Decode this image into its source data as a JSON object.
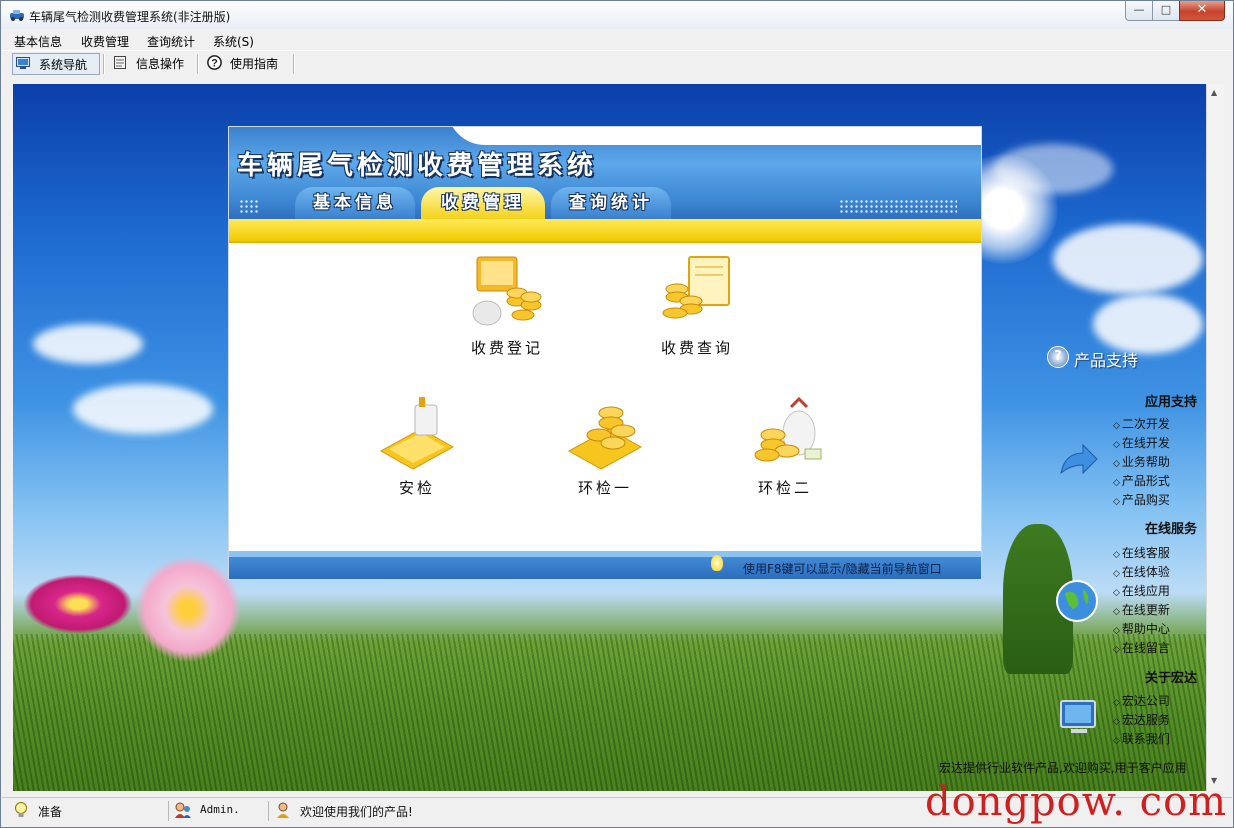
{
  "window": {
    "title": "车辆尾气检测收费管理系统(非注册版)",
    "controls": {
      "minimize": "—",
      "maximize": "□",
      "close": "✕"
    }
  },
  "menubar": {
    "items": [
      {
        "label": "基本信息"
      },
      {
        "label": "收费管理"
      },
      {
        "label": "查询统计"
      },
      {
        "label": "系统(S)"
      }
    ]
  },
  "toolbar": {
    "items": [
      {
        "label": "系统导航",
        "icon": "monitor-icon",
        "active": true
      },
      {
        "label": "信息操作",
        "icon": "document-icon",
        "active": false
      },
      {
        "label": "使用指南",
        "icon": "help-icon",
        "active": false
      }
    ]
  },
  "panel": {
    "title": "车辆尾气检测收费管理系统",
    "tabs": [
      {
        "label": "基本信息",
        "active": false
      },
      {
        "label": "收费管理",
        "active": true
      },
      {
        "label": "查询统计",
        "active": false
      }
    ],
    "functions": [
      {
        "label": "收费登记",
        "icon": "coins-register-icon"
      },
      {
        "label": "收费查询",
        "icon": "coins-query-icon"
      },
      {
        "label": "安检",
        "icon": "safety-check-icon"
      },
      {
        "label": "环检一",
        "icon": "env-check-one-icon"
      },
      {
        "label": "环检二",
        "icon": "env-check-two-icon"
      }
    ],
    "footer_tip": "使用F8键可以显示/隐藏当前导航窗口"
  },
  "sidebar": {
    "support_label": "产品支持",
    "sections": [
      {
        "title": "应用支持",
        "links": [
          "二次开发",
          "在线开发",
          "业务帮助",
          "产品形式",
          "产品购买"
        ]
      },
      {
        "title": "在线服务",
        "links": [
          "在线客服",
          "在线体验",
          "在线应用",
          "在线更新",
          "帮助中心",
          "在线留言"
        ]
      },
      {
        "title": "关于宏达",
        "links": [
          "宏达公司",
          "宏达服务",
          "联系我们"
        ]
      }
    ],
    "marquee": "宏达提供行业软件产品,欢迎购买,用于客户应用"
  },
  "statusbar": {
    "status": "准备",
    "user": "Admin.",
    "message": "欢迎使用我们的产品!"
  },
  "watermark": "dongpow. com",
  "colors": {
    "accent_yellow": "#f3d21b",
    "panel_blue": "#3d86d2",
    "close_red": "#c7432b"
  }
}
